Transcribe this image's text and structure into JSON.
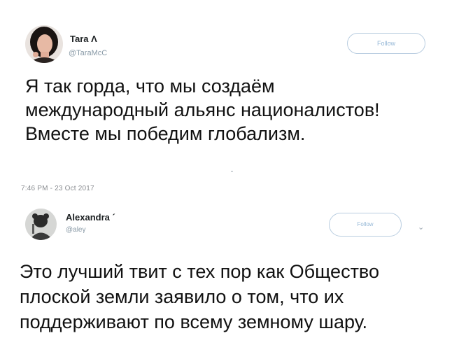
{
  "tweets": [
    {
      "author_name": "Tara Λ",
      "handle": "@TaraMcC",
      "follow_label": "Follow",
      "text_lines": [
        "Я так горда, что мы создаём",
        "международный альянс националистов!",
        "Вместе мы победим глобализм."
      ],
      "timestamp": "7:46 PM - 23 Oct 2017"
    },
    {
      "author_name": "Alexandra ´",
      "handle": "@aleγ",
      "follow_label": "Follow",
      "menu_icon": "chevron-down-icon",
      "text_lines": [
        "Это лучший твит с тех пор как Общество",
        "плоской земли заявило о том, что их",
        "поддерживают по всему земному шару."
      ]
    }
  ]
}
